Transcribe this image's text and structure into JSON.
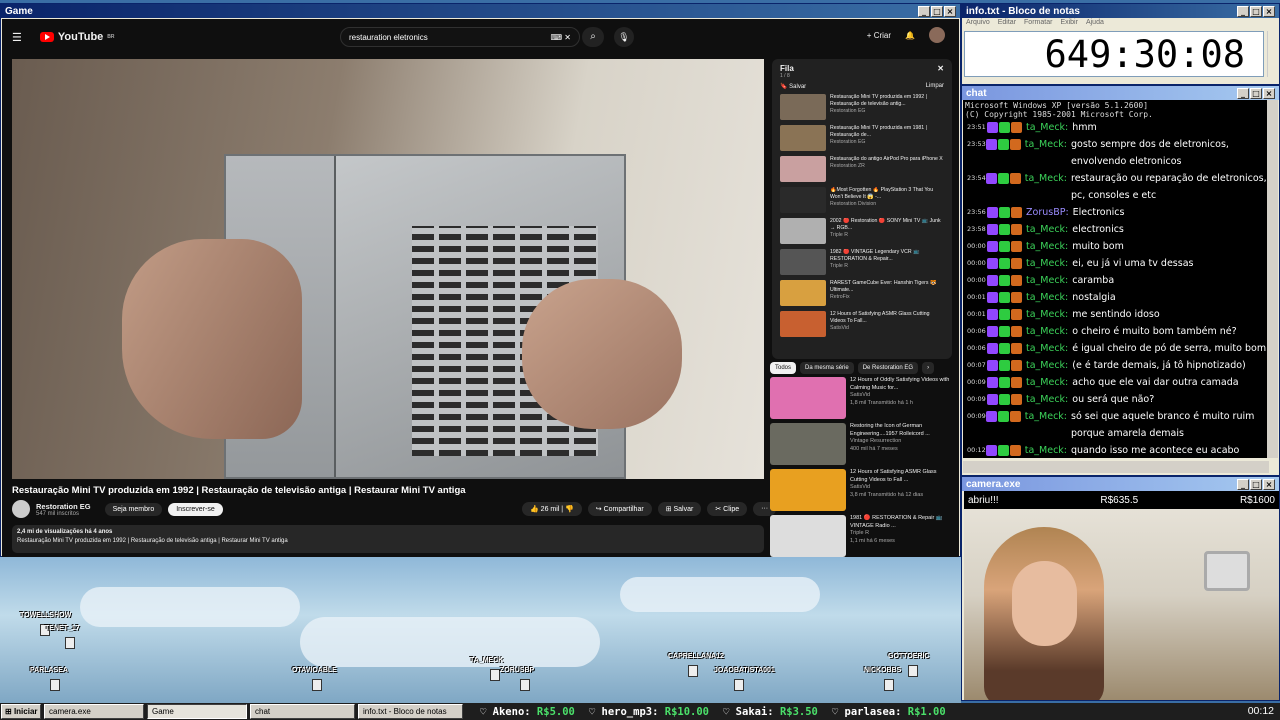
{
  "windows": {
    "game": "Game",
    "note": "info.txt - Bloco de notas",
    "chat": "chat",
    "cam": "camera.exe"
  },
  "note": {
    "menu": [
      "Arquivo",
      "Editar",
      "Formatar",
      "Exibir",
      "Ajuda"
    ],
    "timer": "649:30:08"
  },
  "youtube": {
    "logo": "YouTube",
    "logo_region": "BR",
    "search": "restauration eletronics",
    "create": "Criar",
    "title": "Restauração Mini TV produzida em 1992 | Restauração de televisão antiga | Restaurar Mini TV antiga",
    "channel": "Restoration EG",
    "subs": "547 mil inscritos",
    "join": "Seja membro",
    "subscribe": "Inscrever-se",
    "likes": "26 mil",
    "share": "Compartilhar",
    "save": "Salvar",
    "clip": "Clipe",
    "views": "2,4 mi de visualizações  há 4 anos",
    "desc": "Restauração Mini TV produzida em 1992 | Restauração de televisão antiga | Restaurar Mini TV antiga",
    "queue": {
      "title": "Fila",
      "count": "1 / 8",
      "save": "Salvar",
      "clear": "Limpar",
      "items": [
        {
          "t": "Restauração Mini TV produzida em 1992 | Restauração de televisão antig...",
          "c": "Restoration EG",
          "d": "14:43",
          "color": "#7a6a58"
        },
        {
          "t": "Restauração Mini TV produzida em 1981 | Restauração de...",
          "c": "Restoration EG",
          "d": "14:25",
          "color": "#8a7355"
        },
        {
          "t": "Restauração do antigo AirPod Pro para iPhone X",
          "c": "Restoration ZR",
          "d": "22:43",
          "color": "#c9a0a0"
        },
        {
          "t": "🔥Most Forgotten 🔥 PlayStation 3 That You Won't Believe It 😱 -...",
          "c": "Restoration Division",
          "d": "1:00:37",
          "color": "#2a2a2a"
        },
        {
          "t": "2002 🔴 Restoration 🔴 SONY Mini TV 📺 Junk → RGB...",
          "c": "Triple R",
          "d": "15:43",
          "color": "#b0b0b0"
        },
        {
          "t": "1982 🔴 VINTAGE Legendary VCR 📺 RESTORATION & Repair...",
          "c": "Triple R",
          "d": "22:59",
          "color": "#555"
        },
        {
          "t": "RAREST GameCube Ever: Hanshin Tigers 🐯 Ultimate...",
          "c": "RetroFix",
          "d": "1:14:38",
          "color": "#d8a040"
        },
        {
          "t": "12 Hours of Satisfying ASMR Glass Cutting Videos To Fall...",
          "c": "SatisVid",
          "d": "11:52:40",
          "color": "#c86030"
        }
      ]
    },
    "chips": [
      "Todos",
      "Da mesma série",
      "De Restoration EG"
    ],
    "recs": [
      {
        "t": "12 Hours of Oddly Satisfying Videos with Calming Music for...",
        "c": "SatisVid",
        "m": "1,8 mil  Transmitido há 1 h",
        "d": "11:45:26",
        "color": "#e070b0"
      },
      {
        "t": "Restoring the Icon of German Engineering....1957 Rolleicord ...",
        "c": "Vintage Resurrection",
        "m": "400 mil  há 7 meses",
        "d": "1:23:06",
        "color": "#6a6a60"
      },
      {
        "t": "12 Hours of Satisfying ASMR Glass Cutting Videos to Fall ...",
        "c": "SatisVid",
        "m": "3,8 mil  Transmitido há 12 dias",
        "d": "11:52:55",
        "color": "#e8a020"
      },
      {
        "t": "1981 🔴 RESTORATION & Repair 📺 VINTAGE Radio ...",
        "c": "Triple R",
        "m": "1,1 mi  há 6 meses",
        "d": "",
        "color": "#ddd"
      }
    ]
  },
  "chat": {
    "hdr1": "Microsoft Windows XP [versão 5.1.2600]",
    "hdr2": "(C) Copyright 1985-2001 Microsoft Corp.",
    "messages": [
      {
        "t": "23:51",
        "u": "ta_Meck:",
        "x": "hmm"
      },
      {
        "t": "23:53",
        "u": "ta_Meck:",
        "x": "gosto sempre dos de eletronicos, envolvendo eletronicos"
      },
      {
        "t": "23:54",
        "u": "ta_Meck:",
        "x": "restauração ou reparação de eletronicos, pc, consoles e etc"
      },
      {
        "t": "23:56",
        "u": "ZorusBP:",
        "x": "Electronics",
        "blue": true
      },
      {
        "t": "23:58",
        "u": "ta_Meck:",
        "x": "electronics"
      },
      {
        "t": "00:00",
        "u": "ta_Meck:",
        "x": "muito bom"
      },
      {
        "t": "00:00",
        "u": "ta_Meck:",
        "x": "ei, eu já vi uma tv dessas"
      },
      {
        "t": "00:00",
        "u": "ta_Meck:",
        "x": "caramba"
      },
      {
        "t": "00:01",
        "u": "ta_Meck:",
        "x": "nostalgia"
      },
      {
        "t": "00:01",
        "u": "ta_Meck:",
        "x": "me sentindo idoso"
      },
      {
        "t": "00:06",
        "u": "ta_Meck:",
        "x": "o cheiro é muito bom também né?"
      },
      {
        "t": "00:06",
        "u": "ta_Meck:",
        "x": "é igual cheiro de pó de serra, muito bom"
      },
      {
        "t": "00:07",
        "u": "ta_Meck:",
        "x": "(e é tarde demais, já tô hipnotizado)"
      },
      {
        "t": "00:09",
        "u": "ta_Meck:",
        "x": "acho que ele vai dar outra camada"
      },
      {
        "t": "00:09",
        "u": "ta_Meck:",
        "x": "ou será que não?"
      },
      {
        "t": "00:09",
        "u": "ta_Meck:",
        "x": "só sei que aquele branco é muito ruim porque amarela demais"
      },
      {
        "t": "00:12",
        "u": "ta_Meck:",
        "x": "quando isso me acontece eu acabo virando a noite kkkkkkkkkk"
      }
    ]
  },
  "cam": {
    "left": "abriu!!!",
    "mid": "R$635.5",
    "right": "R$1600"
  },
  "scene": {
    "names": [
      "TOWELLSHOW",
      "TENET_17",
      "PARLASEA",
      "OTAVIOABLE",
      "TA_MECK",
      "ZORUSBP",
      "CAPRELLANA12",
      "JOAOBATISTA001",
      "GOTTOERIC",
      "NICKOBBS"
    ]
  },
  "taskbar": {
    "start": "Iniciar",
    "items": [
      "camera.exe",
      "Game",
      "chat",
      "info.txt - Bloco de notas"
    ],
    "ticker": [
      {
        "n": "Akeno:",
        "a": "R$5.00"
      },
      {
        "n": "hero_mp3:",
        "a": "R$10.00"
      },
      {
        "n": "Sakai:",
        "a": "R$3.50"
      },
      {
        "n": "parlasea:",
        "a": "R$1.00"
      }
    ],
    "clock": "00:12"
  }
}
